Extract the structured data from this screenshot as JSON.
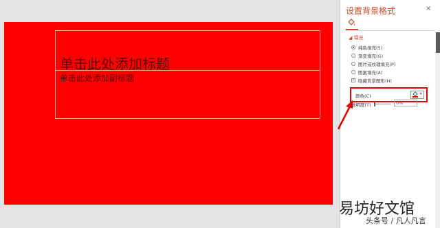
{
  "slide": {
    "title_placeholder": "单击此处添加标题",
    "subtitle_placeholder": "单击此处添加副标题",
    "background_color": "#ff0000"
  },
  "panel": {
    "title": "设置背景格式",
    "close_glyph": "×",
    "icon": "paint-bucket-icon",
    "fill_section": "◢ 填充",
    "fill_options": [
      {
        "label": "纯色填充(S)",
        "selected": true
      },
      {
        "label": "渐变填充(G)",
        "selected": false
      },
      {
        "label": "图片或纹理填充(P)",
        "selected": false
      },
      {
        "label": "图案填充(A)",
        "selected": false
      }
    ],
    "hide_bg_graphics": {
      "label": "隐藏背景图形(H)",
      "checked": true
    },
    "color": {
      "label": "颜色(C)",
      "value": "#e60000",
      "dropdown_glyph": "▾"
    },
    "transparency": {
      "label": "透明度(T)",
      "value": "0%"
    }
  },
  "accent_color": "#d24726",
  "watermark": {
    "main": "易坊好文馆",
    "sub": "头条号 / 凡人凡言"
  }
}
